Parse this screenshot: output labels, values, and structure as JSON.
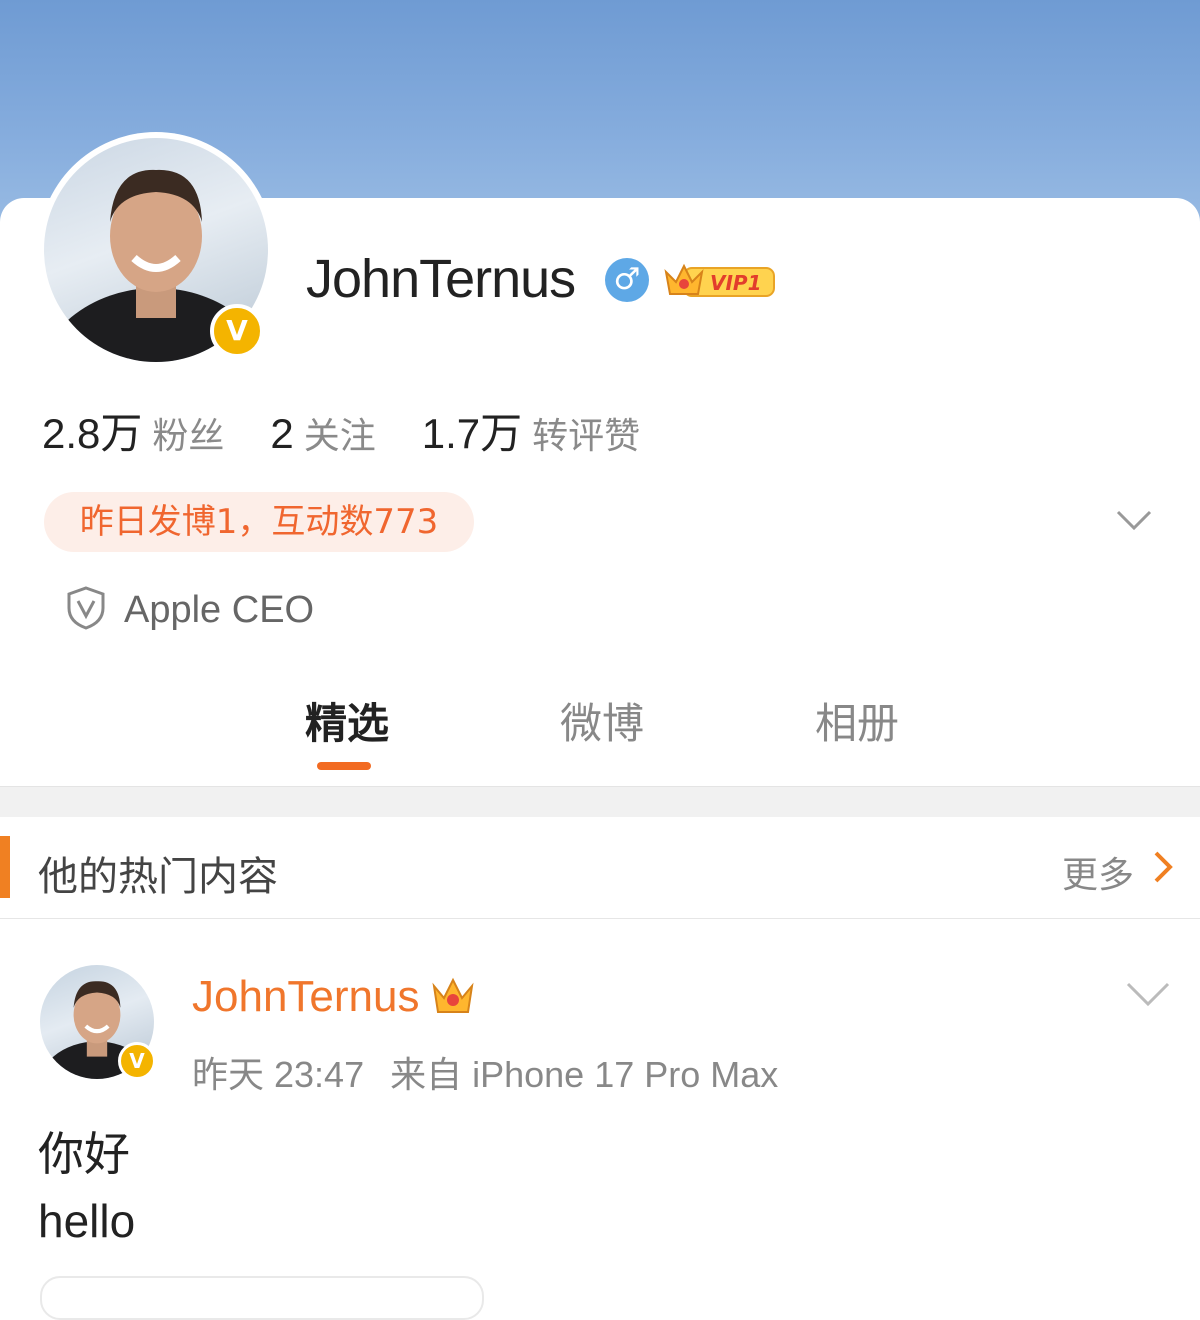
{
  "profile": {
    "username": "JohnTernus",
    "gender_icon": "♂",
    "vip_label": "VIP1",
    "stats": [
      {
        "value": "2.8万",
        "label": "粉丝"
      },
      {
        "value": "2",
        "label": "关注"
      },
      {
        "value": "1.7万",
        "label": "转评赞"
      }
    ],
    "activity": "昨日发博1，互动数773",
    "certification": "Apple CEO",
    "verified_badge": "V"
  },
  "tabs": [
    {
      "label": "精选",
      "active": true
    },
    {
      "label": "微博",
      "active": false
    },
    {
      "label": "相册",
      "active": false
    }
  ],
  "section": {
    "title": "他的热门内容",
    "more_label": "更多"
  },
  "post": {
    "author": "JohnTernus",
    "time": "昨天 23:47",
    "source": "来自 iPhone 17 Pro Max",
    "lines": [
      "你好",
      "hello"
    ]
  },
  "colors": {
    "accent": "#f26b22",
    "verified": "#f4b400",
    "gender": "#5ea8e6",
    "banner": "#7ea6d9"
  }
}
